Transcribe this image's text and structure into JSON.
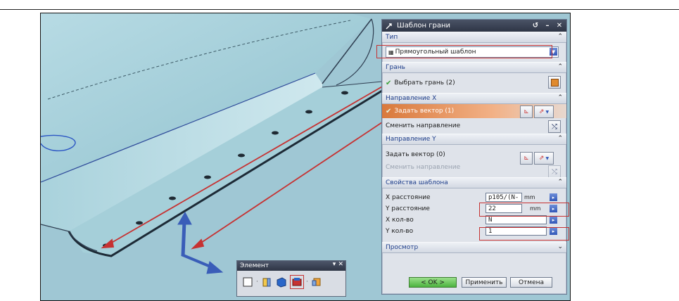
{
  "dialog": {
    "title": "Шаблон грани",
    "sections": {
      "type": {
        "header": "Тип",
        "selected": "Прямоугольный шаблон"
      },
      "face": {
        "header": "Грань",
        "select_label": "Выбрать грань (2)"
      },
      "dir_x": {
        "header": "Направление X",
        "vector_label": "Задать вектор (1)",
        "reverse_label": "Сменить направление"
      },
      "dir_y": {
        "header": "Направление Y",
        "vector_label": "Задать вектор (0)",
        "reverse_label": "Сменить направление"
      },
      "props": {
        "header": "Свойства шаблона",
        "x_distance_label": "X расстояние",
        "x_distance_value": "p105/(N-",
        "x_distance_unit": "mm",
        "y_distance_label": "Y расстояние",
        "y_distance_value": "22",
        "y_distance_unit": "mm",
        "x_count_label": "X кол-во",
        "x_count_value": "N",
        "y_count_label": "Y кол-во",
        "y_count_value": "1"
      },
      "preview": {
        "header": "Просмотр"
      }
    },
    "buttons": {
      "ok": "< OK >",
      "apply": "Применить",
      "cancel": "Отмена"
    }
  },
  "toolbar": {
    "title": "Элемент"
  },
  "colors": {
    "viewport_bg": "#9fc7d4",
    "annotation_red": "#c63232",
    "axis_blue": "#3a5db8"
  }
}
